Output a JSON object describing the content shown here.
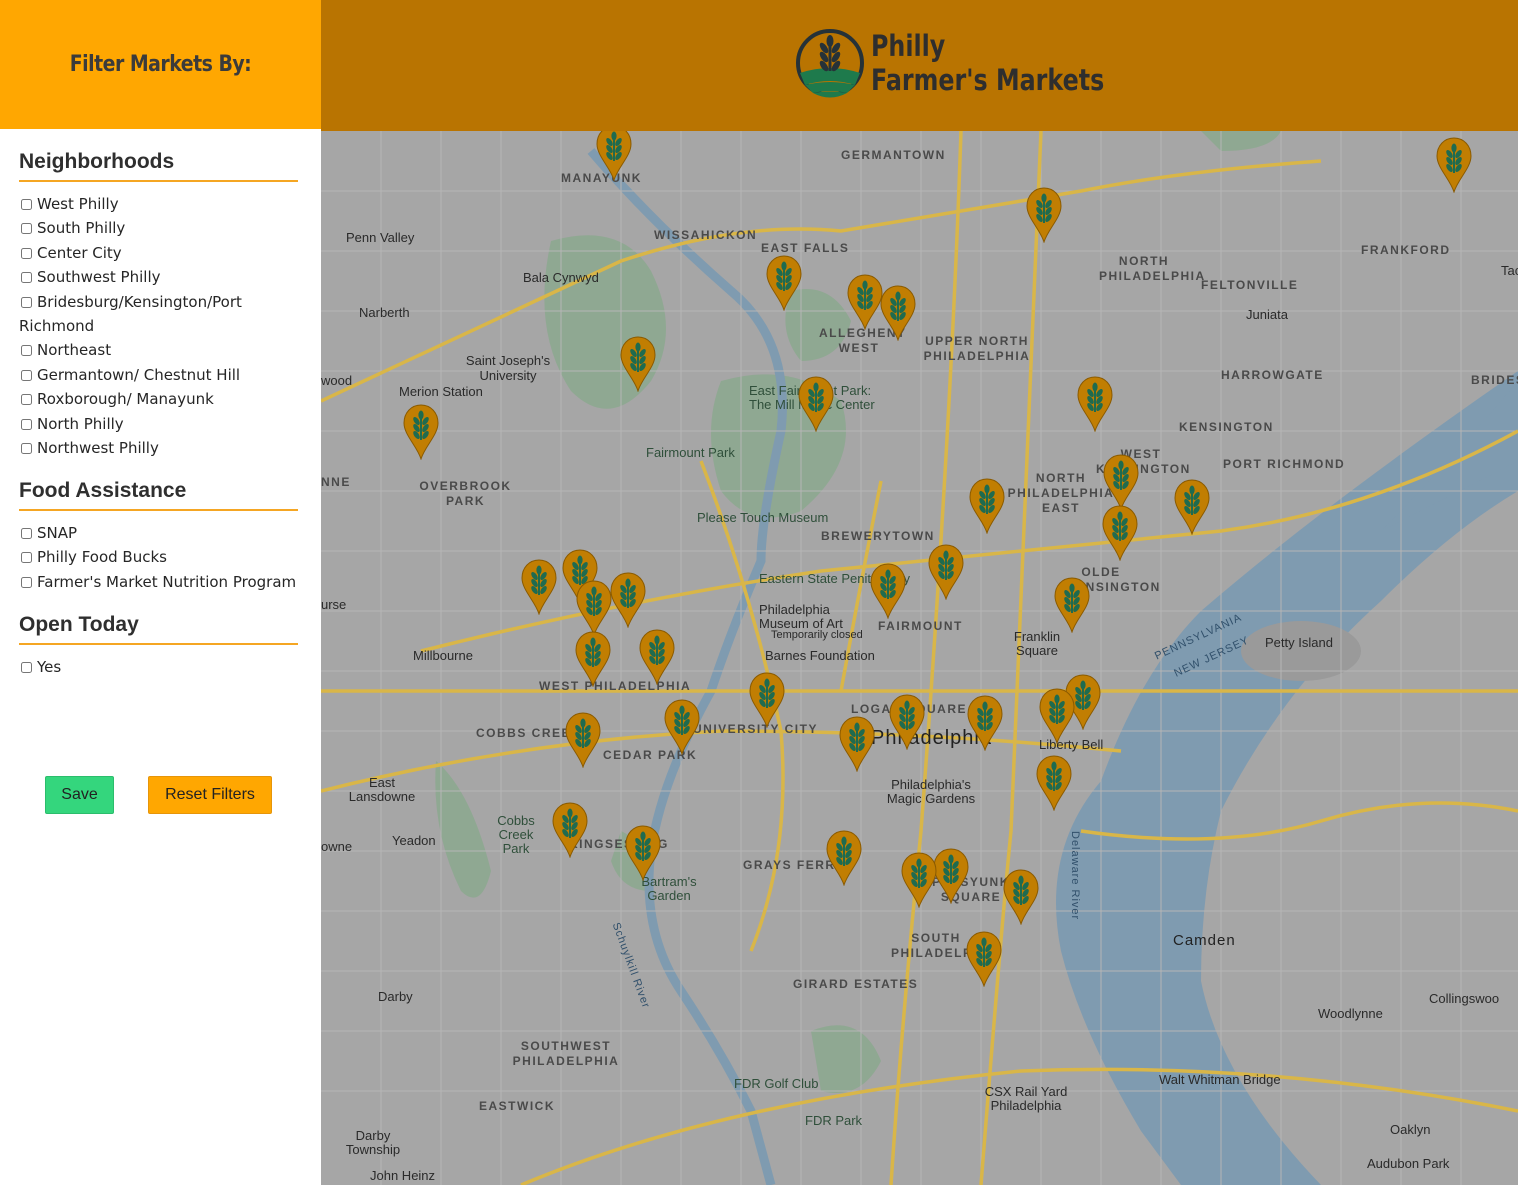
{
  "sidebar": {
    "title": "Filter Markets By:",
    "sections": [
      {
        "heading": "Neighborhoods",
        "options": [
          "West Philly",
          "South Philly",
          "Center City",
          "Southwest Philly",
          "Bridesburg/Kensington/Port Richmond",
          "Northeast",
          "Germantown/ Chestnut Hill",
          "Roxborough/ Manayunk",
          "North Philly",
          "Northwest Philly"
        ]
      },
      {
        "heading": "Food Assistance",
        "options": [
          "SNAP",
          "Philly Food Bucks",
          "Farmer's Market Nutrition Program"
        ]
      },
      {
        "heading": "Open Today",
        "options": [
          "Yes"
        ]
      }
    ],
    "save_label": "Save",
    "reset_label": "Reset Filters"
  },
  "header": {
    "logo_line1": "Philly",
    "logo_line2": "Farmer's Markets"
  },
  "colors": {
    "sidebar_header": "#ffa701",
    "banner": "#b97401",
    "accent_rule": "#f5a623",
    "save_button": "#34d67d",
    "marker_fill": "#c17e02",
    "marker_icon": "#1f6b4f"
  },
  "map": {
    "labels": {
      "germantown": "GERMANTOWN",
      "manayunk": "MANAYUNK",
      "wissahickon": "WISSAHICKON",
      "east_falls": "EAST FALLS",
      "penn_valley": "Penn Valley",
      "bala_cynwyd": "Bala Cynwyd",
      "narberth": "Narberth",
      "north_philadelphia": "NORTH PHILADELPHIA",
      "feltonville": "FELTONVILLE",
      "frankford": "FRANKFORD",
      "juniata": "Juniata",
      "allegheny_west": "ALLEGHENY WEST",
      "upper_north_philadelphia": "UPPER NORTH PHILADELPHIA",
      "harrowgate": "HARROWGATE",
      "bridesburg": "BRIDESB",
      "saint_josephs": "Saint Joseph's University",
      "merion_station": "Merion Station",
      "east_fairmount": "East Fairmount Park: The Mill Music Center",
      "fairmount_park": "Fairmount Park",
      "kensington": "KENSINGTON",
      "port_richmond": "PORT RICHMOND",
      "overbrook_park": "OVERBROOK PARK",
      "north_philadelphia_east": "NORTH PHILADELPHIA EAST",
      "west_kensington": "WEST KENSINGTON",
      "please_touch": "Please Touch Museum",
      "brewerytown": "BREWERYTOWN",
      "eastern_state": "Eastern State Penitentiary",
      "olde_kensington": "OLDE KENSINGTON",
      "philadelphia_museum": "Philadelphia Museum of Art",
      "temporarily_closed": "Temporarily closed",
      "fairmount": "FAIRMOUNT",
      "franklin_square": "Franklin Square",
      "petty_island": "Petty Island",
      "millbourne": "Millbourne",
      "barnes": "Barnes Foundation",
      "west_philadelphia": "WEST PHILADELPHIA",
      "logan_square": "LOGAN SQUARE",
      "philadelphia": "Philadelphia",
      "liberty_bell": "Liberty Bell",
      "cobbs_creek": "COBBS CREEK",
      "university_city": "UNIVERSITY CITY",
      "cedar_park": "CEDAR PARK",
      "east_lansdowne": "East Lansdowne",
      "magic_gardens": "Philadelphia's Magic Gardens",
      "cobbs_creek_park": "Cobbs Creek Park",
      "yeadon": "Yeadon",
      "kingsessing": "KINGSESSING",
      "bartrams_garden": "Bartram's Garden",
      "grays_ferry": "GRAYS FERRY",
      "passyunk_square": "PASSYUNK SQUARE",
      "camden": "Camden",
      "south_philadelphia": "SOUTH PHILADELPHIA",
      "girard_estates": "GIRARD ESTATES",
      "darby": "Darby",
      "collingswood": "Collingswoo",
      "woodlynne": "Woodlynne",
      "southwest_philadelphia": "SOUTHWEST PHILADELPHIA",
      "fdr_golf_club": "FDR Golf Club",
      "walt_whitman_bridge": "Walt Whitman Bridge",
      "csx_rail_yard": "CSX Rail Yard Philadelphia",
      "eastwick": "EASTWICK",
      "fdr_park": "FDR Park",
      "darby_township": "Darby Township",
      "oaklyn": "Oaklyn",
      "audubon_park": "Audubon Park",
      "john_heinz": "John Heinz",
      "delaware_river": "Delaware River",
      "pennsylvania": "PENNSYLVANIA",
      "new_jersey": "NEW JERSEY",
      "schuylkill_river": "Schuylkill River",
      "tacony": "Tac",
      "wood": "wood",
      "nne": "NNE",
      "owne": "owne",
      "urse": "urse"
    },
    "markers": [
      "market-01",
      "market-02",
      "market-03",
      "market-04",
      "market-05",
      "market-06",
      "market-07",
      "market-08",
      "market-09",
      "market-10",
      "market-11",
      "market-12",
      "market-13",
      "market-14",
      "market-15",
      "market-16",
      "market-17",
      "market-18",
      "market-19",
      "market-20",
      "market-21",
      "market-22",
      "market-23",
      "market-24",
      "market-25",
      "market-26",
      "market-27",
      "market-28",
      "market-29",
      "market-30",
      "market-31",
      "market-32",
      "market-33",
      "market-34",
      "market-35",
      "market-36",
      "market-37",
      "market-38",
      "market-39",
      "market-40",
      "market-41"
    ]
  }
}
